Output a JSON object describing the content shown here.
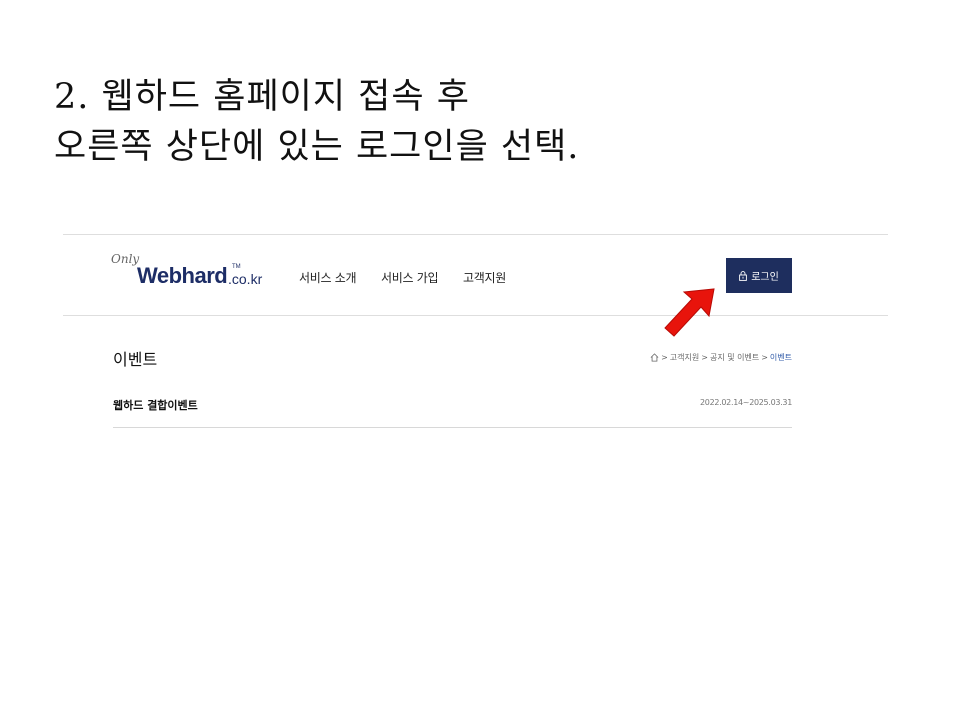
{
  "instruction": {
    "line1": "2. 웹하드 홈페이지 접속 후",
    "line2": "오른쪽 상단에 있는 로그인을 선택."
  },
  "site": {
    "logo": {
      "only": "Only",
      "main": "Webhard",
      "tm": "TM",
      "tld": ".co.kr"
    },
    "nav": [
      "서비스 소개",
      "서비스 가입",
      "고객지원"
    ],
    "login_label": "로그인",
    "colors": {
      "brand": "#1e2e5e",
      "arrow": "#e8140c",
      "breadcrumb_active": "#2f5aa8"
    }
  },
  "page": {
    "title": "이벤트",
    "breadcrumb": [
      ">",
      "고객지원",
      ">",
      "공지 및 이벤트",
      ">"
    ],
    "breadcrumb_current": "이벤트",
    "event": {
      "title": "웹하드 결합이벤트",
      "date": "2022.02.14~2025.03.31"
    }
  }
}
